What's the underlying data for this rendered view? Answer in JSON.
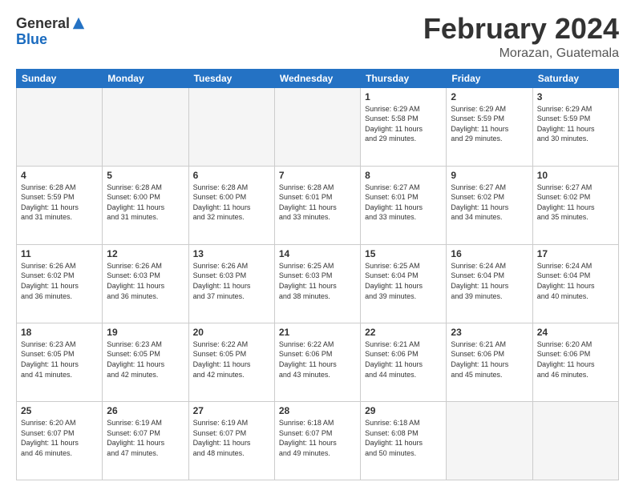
{
  "header": {
    "logo_general": "General",
    "logo_blue": "Blue",
    "month_title": "February 2024",
    "location": "Morazan, Guatemala"
  },
  "weekdays": [
    "Sunday",
    "Monday",
    "Tuesday",
    "Wednesday",
    "Thursday",
    "Friday",
    "Saturday"
  ],
  "weeks": [
    [
      {
        "day": "",
        "info": ""
      },
      {
        "day": "",
        "info": ""
      },
      {
        "day": "",
        "info": ""
      },
      {
        "day": "",
        "info": ""
      },
      {
        "day": "1",
        "info": "Sunrise: 6:29 AM\nSunset: 5:58 PM\nDaylight: 11 hours\nand 29 minutes."
      },
      {
        "day": "2",
        "info": "Sunrise: 6:29 AM\nSunset: 5:59 PM\nDaylight: 11 hours\nand 29 minutes."
      },
      {
        "day": "3",
        "info": "Sunrise: 6:29 AM\nSunset: 5:59 PM\nDaylight: 11 hours\nand 30 minutes."
      }
    ],
    [
      {
        "day": "4",
        "info": "Sunrise: 6:28 AM\nSunset: 5:59 PM\nDaylight: 11 hours\nand 31 minutes."
      },
      {
        "day": "5",
        "info": "Sunrise: 6:28 AM\nSunset: 6:00 PM\nDaylight: 11 hours\nand 31 minutes."
      },
      {
        "day": "6",
        "info": "Sunrise: 6:28 AM\nSunset: 6:00 PM\nDaylight: 11 hours\nand 32 minutes."
      },
      {
        "day": "7",
        "info": "Sunrise: 6:28 AM\nSunset: 6:01 PM\nDaylight: 11 hours\nand 33 minutes."
      },
      {
        "day": "8",
        "info": "Sunrise: 6:27 AM\nSunset: 6:01 PM\nDaylight: 11 hours\nand 33 minutes."
      },
      {
        "day": "9",
        "info": "Sunrise: 6:27 AM\nSunset: 6:02 PM\nDaylight: 11 hours\nand 34 minutes."
      },
      {
        "day": "10",
        "info": "Sunrise: 6:27 AM\nSunset: 6:02 PM\nDaylight: 11 hours\nand 35 minutes."
      }
    ],
    [
      {
        "day": "11",
        "info": "Sunrise: 6:26 AM\nSunset: 6:02 PM\nDaylight: 11 hours\nand 36 minutes."
      },
      {
        "day": "12",
        "info": "Sunrise: 6:26 AM\nSunset: 6:03 PM\nDaylight: 11 hours\nand 36 minutes."
      },
      {
        "day": "13",
        "info": "Sunrise: 6:26 AM\nSunset: 6:03 PM\nDaylight: 11 hours\nand 37 minutes."
      },
      {
        "day": "14",
        "info": "Sunrise: 6:25 AM\nSunset: 6:03 PM\nDaylight: 11 hours\nand 38 minutes."
      },
      {
        "day": "15",
        "info": "Sunrise: 6:25 AM\nSunset: 6:04 PM\nDaylight: 11 hours\nand 39 minutes."
      },
      {
        "day": "16",
        "info": "Sunrise: 6:24 AM\nSunset: 6:04 PM\nDaylight: 11 hours\nand 39 minutes."
      },
      {
        "day": "17",
        "info": "Sunrise: 6:24 AM\nSunset: 6:04 PM\nDaylight: 11 hours\nand 40 minutes."
      }
    ],
    [
      {
        "day": "18",
        "info": "Sunrise: 6:23 AM\nSunset: 6:05 PM\nDaylight: 11 hours\nand 41 minutes."
      },
      {
        "day": "19",
        "info": "Sunrise: 6:23 AM\nSunset: 6:05 PM\nDaylight: 11 hours\nand 42 minutes."
      },
      {
        "day": "20",
        "info": "Sunrise: 6:22 AM\nSunset: 6:05 PM\nDaylight: 11 hours\nand 42 minutes."
      },
      {
        "day": "21",
        "info": "Sunrise: 6:22 AM\nSunset: 6:06 PM\nDaylight: 11 hours\nand 43 minutes."
      },
      {
        "day": "22",
        "info": "Sunrise: 6:21 AM\nSunset: 6:06 PM\nDaylight: 11 hours\nand 44 minutes."
      },
      {
        "day": "23",
        "info": "Sunrise: 6:21 AM\nSunset: 6:06 PM\nDaylight: 11 hours\nand 45 minutes."
      },
      {
        "day": "24",
        "info": "Sunrise: 6:20 AM\nSunset: 6:06 PM\nDaylight: 11 hours\nand 46 minutes."
      }
    ],
    [
      {
        "day": "25",
        "info": "Sunrise: 6:20 AM\nSunset: 6:07 PM\nDaylight: 11 hours\nand 46 minutes."
      },
      {
        "day": "26",
        "info": "Sunrise: 6:19 AM\nSunset: 6:07 PM\nDaylight: 11 hours\nand 47 minutes."
      },
      {
        "day": "27",
        "info": "Sunrise: 6:19 AM\nSunset: 6:07 PM\nDaylight: 11 hours\nand 48 minutes."
      },
      {
        "day": "28",
        "info": "Sunrise: 6:18 AM\nSunset: 6:07 PM\nDaylight: 11 hours\nand 49 minutes."
      },
      {
        "day": "29",
        "info": "Sunrise: 6:18 AM\nSunset: 6:08 PM\nDaylight: 11 hours\nand 50 minutes."
      },
      {
        "day": "",
        "info": ""
      },
      {
        "day": "",
        "info": ""
      }
    ]
  ]
}
